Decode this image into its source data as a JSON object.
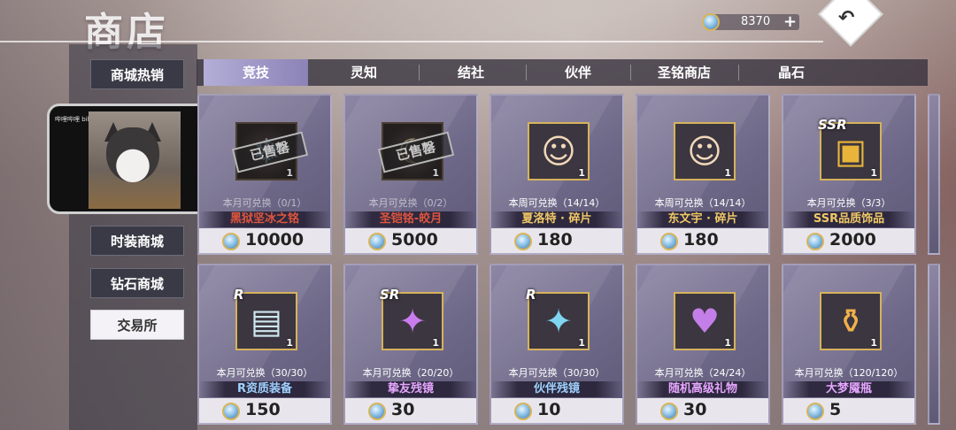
{
  "header": {
    "title": "商店"
  },
  "currency": {
    "amount": "8370",
    "plus_label": "+",
    "icon": "coin-icon"
  },
  "back_button": {
    "icon": "return-arrow-icon",
    "label": "↶"
  },
  "sidebar": {
    "items": [
      {
        "label": "商城热销",
        "active": false
      },
      {
        "label": "时装商城",
        "active": false
      },
      {
        "label": "钻石商城",
        "active": false
      },
      {
        "label": "交易所",
        "active": true
      }
    ]
  },
  "video_overlay": {
    "watermark": "哔哩哔哩 bilibili"
  },
  "tabs": [
    {
      "label": "竞技",
      "active": true
    },
    {
      "label": "灵知",
      "active": false
    },
    {
      "label": "结社",
      "active": false
    },
    {
      "label": "伙伴",
      "active": false
    },
    {
      "label": "圣铭商店",
      "active": false
    },
    {
      "label": "晶石",
      "active": false
    }
  ],
  "items": [
    {
      "name": "黑狱坚冰之铭",
      "limit": "本月可兑换（0/1）",
      "price": "10000",
      "qty": "1",
      "sold_out": true,
      "stamp": "已售罄",
      "name_color": "#e0553f",
      "icon": "ice-seal-emblem-icon"
    },
    {
      "name": "圣铠铭-皎月",
      "limit": "本月可兑换（0/2）",
      "price": "5000",
      "qty": "1",
      "sold_out": true,
      "stamp": "已售罄",
      "name_color": "#e0553f",
      "icon": "moon-seal-emblem-icon"
    },
    {
      "name": "夏洛特 · 碎片",
      "limit": "本周可兑换（14/14）",
      "price": "180",
      "qty": "1",
      "sold_out": false,
      "name_color": "#f0c866",
      "icon": "character-portrait-icon"
    },
    {
      "name": "东文宇 · 碎片",
      "limit": "本周可兑换（14/14）",
      "price": "180",
      "qty": "1",
      "sold_out": false,
      "name_color": "#f0c866",
      "icon": "character-portrait-icon"
    },
    {
      "name": "SSR品质饰品",
      "limit": "本月可兑换（3/3）",
      "price": "2000",
      "qty": "1",
      "sold_out": false,
      "rarity": "SSR",
      "name_color": "#f0c866",
      "icon": "treasure-chest-icon"
    },
    {
      "name": "R资质装备",
      "limit": "本月可兑换（30/30）",
      "price": "150",
      "qty": "1",
      "sold_out": false,
      "rarity": "R",
      "name_color": "#9fd2ff",
      "icon": "equipment-case-icon"
    },
    {
      "name": "挚友残镜",
      "limit": "本月可兑换（20/20）",
      "price": "30",
      "qty": "1",
      "sold_out": false,
      "rarity": "SR",
      "name_color": "#e6a6ff",
      "icon": "puzzle-shard-icon"
    },
    {
      "name": "伙伴残镜",
      "limit": "本月可兑换（30/30）",
      "price": "10",
      "qty": "1",
      "sold_out": false,
      "rarity": "R",
      "name_color": "#9fd2ff",
      "icon": "puzzle-shard-icon"
    },
    {
      "name": "随机高级礼物",
      "limit": "本月可兑换（24/24）",
      "price": "30",
      "qty": "1",
      "sold_out": false,
      "name_color": "#e6a6ff",
      "icon": "heart-gift-box-icon"
    },
    {
      "name": "大梦魇瓶",
      "limit": "本月可兑换（120/120）",
      "price": "5",
      "qty": "1",
      "sold_out": false,
      "name_color": "#e6a6ff",
      "icon": "potion-bottle-icon"
    }
  ]
}
